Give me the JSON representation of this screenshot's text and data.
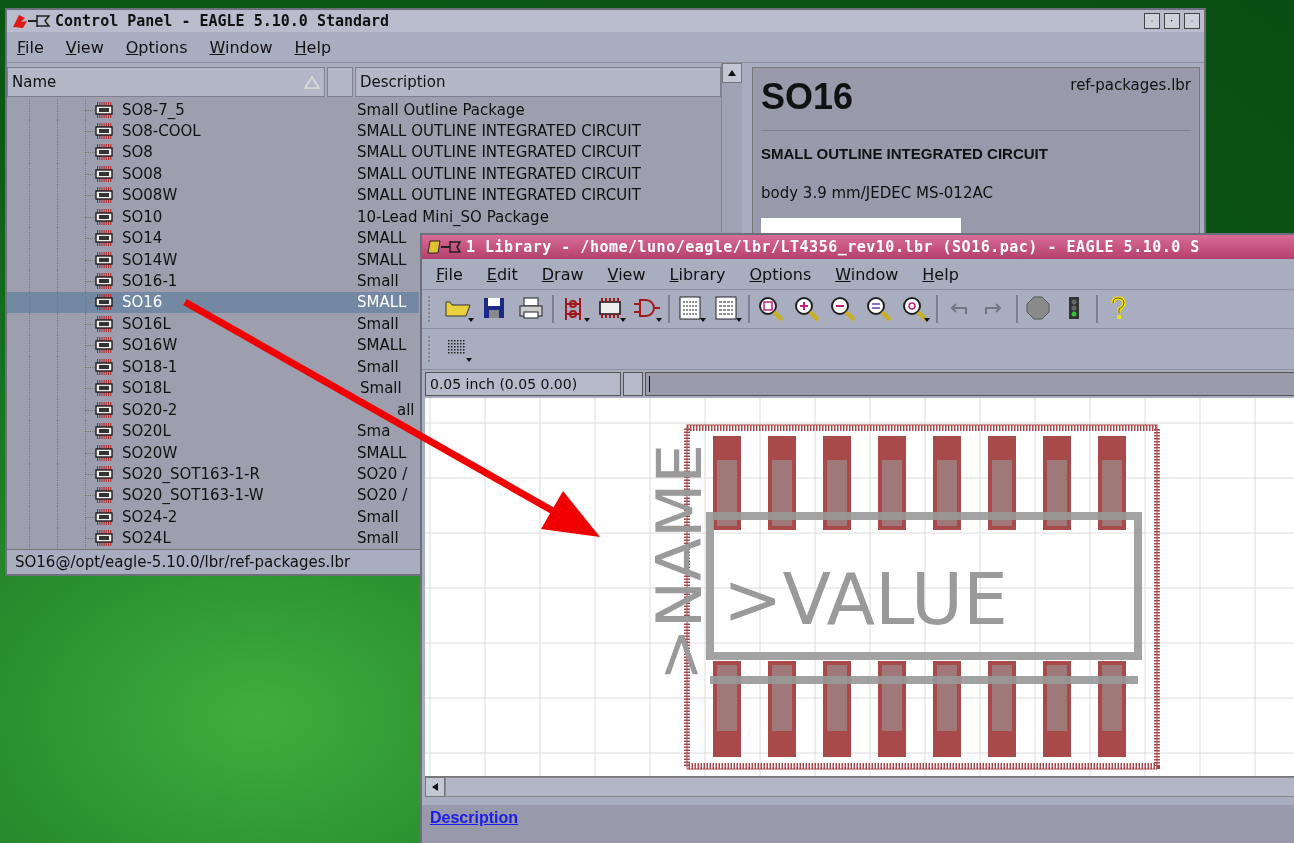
{
  "control_panel": {
    "title": "Control Panel - EAGLE 5.10.0 Standard",
    "menu": [
      "File",
      "View",
      "Options",
      "Window",
      "Help"
    ],
    "columns": {
      "name": "Name",
      "description": "Description"
    },
    "rows": [
      {
        "name": "SO8-7_5",
        "description": "Small Outline Package",
        "selected": false
      },
      {
        "name": "SO8-COOL",
        "description": "SMALL OUTLINE INTEGRATED CIRCUIT",
        "selected": false
      },
      {
        "name": "SO8",
        "description": "SMALL OUTLINE INTEGRATED CIRCUIT",
        "selected": false
      },
      {
        "name": "SO08",
        "description": "SMALL OUTLINE INTEGRATED CIRCUIT",
        "selected": false
      },
      {
        "name": "SO08W",
        "description": "SMALL OUTLINE INTEGRATED CIRCUIT",
        "selected": false
      },
      {
        "name": "SO10",
        "description": "10-Lead Mini_SO Package",
        "selected": false
      },
      {
        "name": "SO14",
        "description": "SMALL",
        "selected": false
      },
      {
        "name": "SO14W",
        "description": "SMALL",
        "selected": false
      },
      {
        "name": "SO16-1",
        "description": "Small",
        "selected": false
      },
      {
        "name": "SO16",
        "description": "SMALL",
        "selected": true
      },
      {
        "name": "SO16L",
        "description": "Small",
        "selected": false
      },
      {
        "name": "SO16W",
        "description": "SMALL",
        "selected": false
      },
      {
        "name": "SO18-1",
        "description": "Small",
        "selected": false
      },
      {
        "name": "SO18L",
        "description": "Small",
        "selected": false
      },
      {
        "name": "SO20-2",
        "description": "all",
        "selected": false
      },
      {
        "name": "SO20L",
        "description": "Sma",
        "selected": false
      },
      {
        "name": "SO20W",
        "description": "SMALL",
        "selected": false
      },
      {
        "name": "SO20_SOT163-1-R",
        "description": "SO20 /",
        "selected": false
      },
      {
        "name": "SO20_SOT163-1-W",
        "description": "SO20 /",
        "selected": false
      },
      {
        "name": "SO24-2",
        "description": "Small",
        "selected": false
      },
      {
        "name": "SO24L",
        "description": "Small",
        "selected": false
      }
    ],
    "status": "SO16@/opt/eagle-5.10.0/lbr/ref-packages.lbr",
    "info": {
      "title": "SO16",
      "library": "ref-packages.lbr",
      "heading": "SMALL OUTLINE INTEGRATED CIRCUIT",
      "detail": "body 3.9 mm/JEDEC MS-012AC"
    }
  },
  "library_window": {
    "title": "1 Library - /home/luno/eagle/lbr/LT4356_rev10.lbr (SO16.pac) - EAGLE 5.10.0 S",
    "menu": [
      "File",
      "Edit",
      "Draw",
      "View",
      "Library",
      "Options",
      "Window",
      "Help"
    ],
    "toolbar": [
      {
        "kind": "open",
        "disabled": false
      },
      {
        "kind": "save",
        "disabled": false
      },
      {
        "kind": "print",
        "disabled": false
      },
      {
        "kind": "sep"
      },
      {
        "kind": "schematic",
        "disabled": false
      },
      {
        "kind": "chip",
        "disabled": false
      },
      {
        "kind": "gate",
        "disabled": false
      },
      {
        "kind": "sep"
      },
      {
        "kind": "script",
        "disabled": false
      },
      {
        "kind": "ulp",
        "disabled": false
      },
      {
        "kind": "sep"
      },
      {
        "kind": "zoom-fit",
        "disabled": false
      },
      {
        "kind": "zoom-in",
        "disabled": false
      },
      {
        "kind": "zoom-out",
        "disabled": false
      },
      {
        "kind": "zoom-redraw",
        "disabled": false
      },
      {
        "kind": "zoom-select",
        "disabled": false
      },
      {
        "kind": "sep"
      },
      {
        "kind": "undo",
        "disabled": true
      },
      {
        "kind": "redo",
        "disabled": true
      },
      {
        "kind": "sep"
      },
      {
        "kind": "stop",
        "disabled": false
      },
      {
        "kind": "go",
        "disabled": false
      },
      {
        "kind": "sep"
      },
      {
        "kind": "help",
        "disabled": false
      }
    ],
    "grid_field": "0.05 inch (0.05 0.00)",
    "canvas": {
      "name_label": ">NAME",
      "value_label": ">VALUE"
    },
    "description_link": "Description"
  }
}
